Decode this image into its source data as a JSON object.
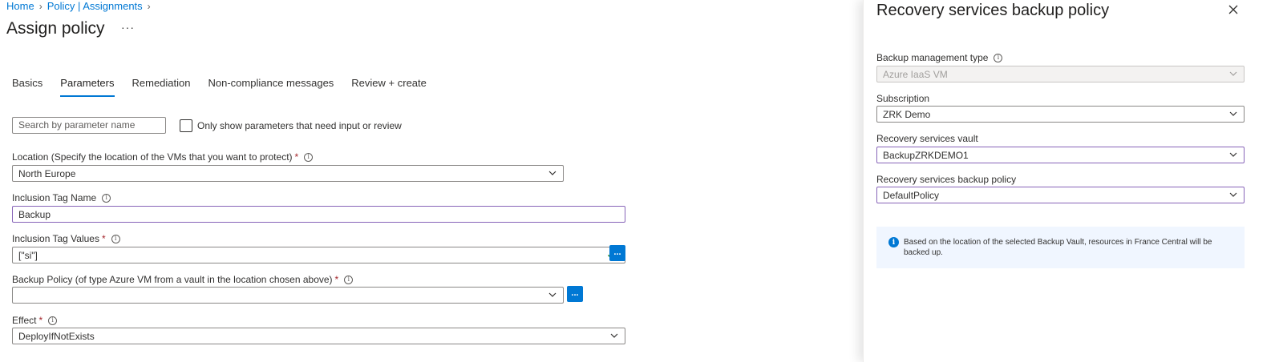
{
  "breadcrumb": {
    "home": "Home",
    "assignments": "Policy | Assignments"
  },
  "page": {
    "title": "Assign policy",
    "more": "···"
  },
  "tabs": [
    {
      "label": "Basics"
    },
    {
      "label": "Parameters"
    },
    {
      "label": "Remediation"
    },
    {
      "label": "Non-compliance messages"
    },
    {
      "label": "Review + create"
    }
  ],
  "search": {
    "placeholder": "Search by parameter name"
  },
  "filter": {
    "checkbox_label": "Only show parameters that need input or review",
    "checked": false
  },
  "fields": {
    "location": {
      "label": "Location (Specify the location of the VMs that you want to protect)",
      "required": "*",
      "value": "North Europe"
    },
    "inclusion_tag_name": {
      "label": "Inclusion Tag Name",
      "value": "Backup"
    },
    "inclusion_tag_values": {
      "label": "Inclusion Tag Values",
      "required": "*",
      "value": "[\"si\"]",
      "button": "..."
    },
    "backup_policy": {
      "label": "Backup Policy (of type Azure VM from a vault in the location chosen above)",
      "required": "*",
      "value": "",
      "button": "..."
    },
    "effect": {
      "label": "Effect",
      "required": "*",
      "value": "DeployIfNotExists"
    }
  },
  "panel": {
    "title": "Recovery services backup policy",
    "backup_management_type": {
      "label": "Backup management type",
      "value": "Azure IaaS VM"
    },
    "subscription": {
      "label": "Subscription",
      "value": "ZRK Demo"
    },
    "vault": {
      "label": "Recovery services vault",
      "value": "BackupZRKDEMO1"
    },
    "policy": {
      "label": "Recovery services backup policy",
      "value": "DefaultPolicy"
    },
    "info": "Based on the location of the selected Backup Vault, resources in France Central will be backed up."
  },
  "colors": {
    "accent": "#0078d4",
    "focus_border": "#8764b8",
    "required": "#a4262c",
    "info_bg": "#f0f6ff"
  },
  "icons": {
    "info": "info-icon",
    "chevron": "chevron-down-icon",
    "check": "checkmark-icon",
    "close": "close-icon"
  }
}
